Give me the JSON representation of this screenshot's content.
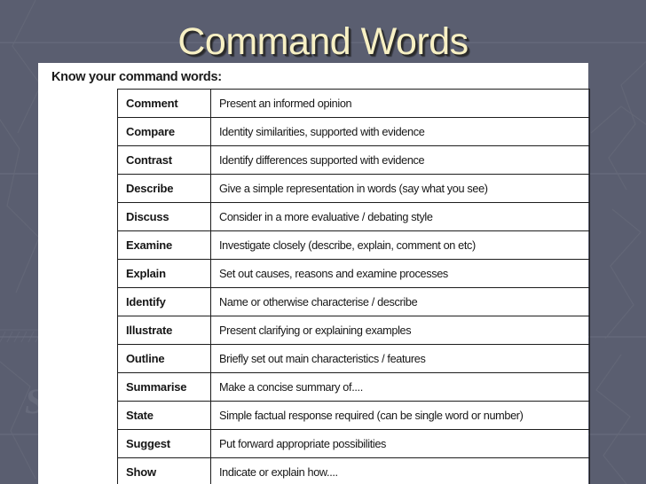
{
  "slide": {
    "title": "Command Words",
    "heading": "Know your command words:",
    "background_color": "#5a5e70",
    "title_color": "#f7f0c4",
    "panel_color": "#ffffff",
    "table_border_color": "#1d1d1d",
    "watermark_glyph": "S"
  },
  "table": {
    "rows": [
      {
        "term": "Comment",
        "definition": "Present an informed opinion"
      },
      {
        "term": "Compare",
        "definition": "Identity similarities, supported with evidence"
      },
      {
        "term": "Contrast",
        "definition": "Identify differences supported with evidence"
      },
      {
        "term": "Describe",
        "definition": "Give a simple representation in words (say what you see)"
      },
      {
        "term": "Discuss",
        "definition": "Consider in a more evaluative / debating style"
      },
      {
        "term": "Examine",
        "definition": "Investigate closely (describe, explain, comment on etc)"
      },
      {
        "term": "Explain",
        "definition": "Set out causes, reasons and examine processes"
      },
      {
        "term": "Identify",
        "definition": "Name or otherwise characterise / describe"
      },
      {
        "term": "Illustrate",
        "definition": "Present clarifying or explaining examples"
      },
      {
        "term": "Outline",
        "definition": "Briefly set out main characteristics / features"
      },
      {
        "term": "Summarise",
        "definition": "Make a concise summary of...."
      },
      {
        "term": "State",
        "definition": "Simple factual response required (can be single word or number)"
      },
      {
        "term": "Suggest",
        "definition": "Put forward appropriate possibilities"
      },
      {
        "term": "Show",
        "definition": "Indicate or explain how...."
      }
    ]
  }
}
